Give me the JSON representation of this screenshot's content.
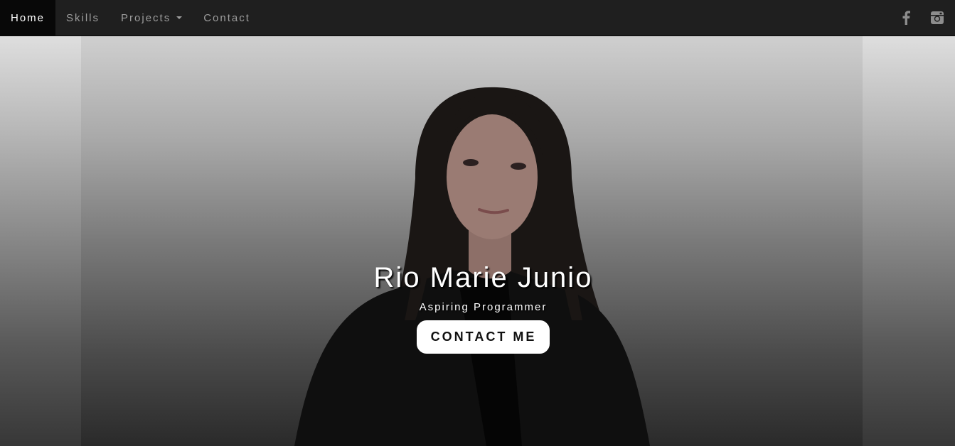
{
  "nav": {
    "items": [
      {
        "label": "Home",
        "active": true
      },
      {
        "label": "Skills",
        "active": false
      },
      {
        "label": "Projects",
        "active": false,
        "dropdown": true
      },
      {
        "label": "Contact",
        "active": false
      }
    ],
    "social": [
      {
        "icon": "facebook-icon"
      },
      {
        "icon": "instagram-icon"
      }
    ]
  },
  "hero": {
    "name": "Rio Marie Junio",
    "tagline": "Aspiring Programmer",
    "cta_label": "CONTACT ME"
  },
  "colors": {
    "navbar_bg": "#1f1f1f",
    "nav_active_bg": "#080808",
    "nav_text": "#9d9d9d",
    "button_bg": "#ffffff"
  }
}
